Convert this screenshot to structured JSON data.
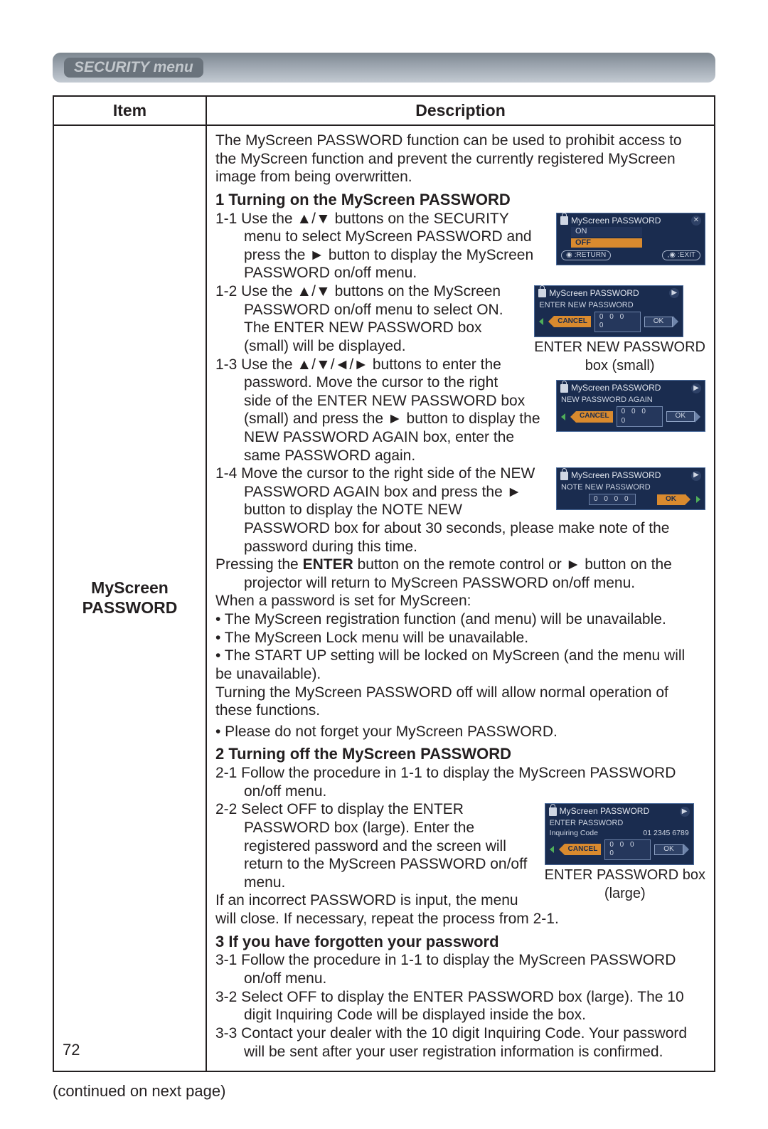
{
  "header": {
    "title": "SECURITY menu"
  },
  "table": {
    "head_item": "Item",
    "head_desc": "Description",
    "item_name_line1": "MyScreen",
    "item_name_line2": "PASSWORD"
  },
  "intro": "The MyScreen PASSWORD function can be used to prohibit access to the MyScreen function and prevent the currently registered MyScreen image from being overwritten.",
  "s1": {
    "heading": "1 Turning on the MyScreen PASSWORD",
    "p1": "1-1 Use the ▲/▼ buttons on the SECURITY menu to select MyScreen PASSWORD and press the ► button to display the MyScreen PASSWORD on/off menu.",
    "p2": "1-2 Use the ▲/▼ buttons on the MyScreen PASSWORD on/off menu to select ON. The ENTER NEW PASSWORD box (small) will be displayed.",
    "p3": "1-3 Use the ▲/▼/◄/► buttons to enter the password. Move the cursor to the right side of the ENTER NEW PASSWORD box (small) and press the ► button to display the NEW PASSWORD AGAIN box, enter the same PASSWORD again.",
    "p4": "1-4 Move the cursor to the right side of the NEW PASSWORD AGAIN box and press the ► button to display the NOTE NEW PASSWORD box for about 30 seconds, please make note of the password during this time.",
    "after_a": "Pressing the ",
    "after_b": " button on the remote control or ► button on the projector will return to MyScreen PASSWORD on/off menu.",
    "enter_label": "ENTER",
    "when_set": "When a password is set for MyScreen:",
    "b1": "• The MyScreen registration function (and menu) will be unavailable.",
    "b2": "• The MyScreen Lock menu will be unavailable.",
    "b3": "• The START UP setting will be locked on MyScreen (and the menu will be unavailable).",
    "off_allows": "Turning the MyScreen PASSWORD off will allow normal operation of these functions.",
    "dont_forget": "• Please do not forget your MyScreen PASSWORD."
  },
  "s2": {
    "heading": "2 Turning off the MyScreen PASSWORD",
    "p1": "2-1 Follow the procedure in 1-1 to display the MyScreen PASSWORD on/off menu.",
    "p2": "2-2 Select OFF to display the ENTER PASSWORD box (large). Enter the registered password and the screen will return to the MyScreen PASSWORD on/off menu.",
    "after": "If an incorrect PASSWORD is input, the menu will close. If necessary, repeat the process from 2-1."
  },
  "s3": {
    "heading": "3 If you have forgotten your password",
    "p1": "3-1 Follow the procedure in 1-1 to display the MyScreen PASSWORD on/off menu.",
    "p2": "3-2 Select OFF to display the ENTER PASSWORD box (large). The 10 digit Inquiring Code will be displayed inside the box.",
    "p3": "3-3 Contact your dealer with the 10 digit Inquiring Code. Your password will be sent after your user registration information is confirmed."
  },
  "dialogs": {
    "d1": {
      "title": "MyScreen PASSWORD",
      "on": "ON",
      "off": "OFF",
      "return": ":RETURN",
      "exit": ":EXIT"
    },
    "d2": {
      "title": "MyScreen PASSWORD",
      "sub": "ENTER NEW PASSWORD",
      "cancel": "CANCEL",
      "pin": "0 0 0 0",
      "ok": "OK",
      "caption1": "ENTER NEW PASSWORD",
      "caption2": "box (small)"
    },
    "d3": {
      "title": "MyScreen PASSWORD",
      "sub": "NEW PASSWORD AGAIN",
      "cancel": "CANCEL",
      "pin": "0 0 0 0",
      "ok": "OK"
    },
    "d4": {
      "title": "MyScreen PASSWORD",
      "sub": "NOTE NEW PASSWORD",
      "pin": "0 0 0 0",
      "ok": "OK"
    },
    "d5": {
      "title": "MyScreen PASSWORD",
      "sub": "ENTER PASSWORD",
      "inq_label": "Inquiring Code",
      "inq_code": "01 2345 6789",
      "cancel": "CANCEL",
      "pin": "0 0 0 0",
      "ok": "OK",
      "caption1": "ENTER PASSWORD box",
      "caption2": "(large)"
    }
  },
  "footer": {
    "continued": "(continued on next page)",
    "page": "72"
  }
}
